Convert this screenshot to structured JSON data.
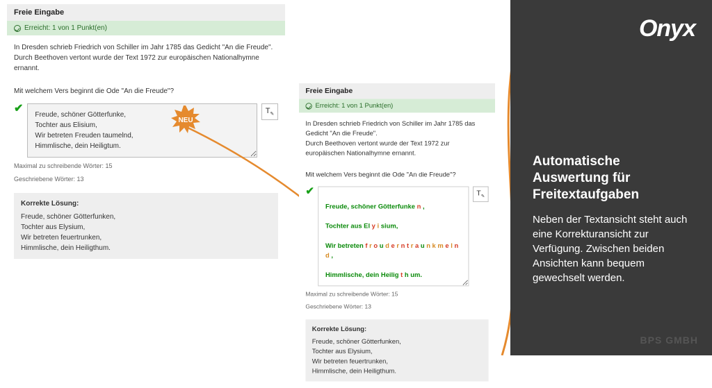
{
  "brand": {
    "logo": "Onyx",
    "footer": "BPS GMBH"
  },
  "promo": {
    "title": "Automatische Auswertung für Freitextaufgaben",
    "body": "Neben der Textansicht steht auch eine Korrekturansicht zur Verfügung. Zwischen beiden Ansichten kann bequem gewechselt werden."
  },
  "badge": {
    "label": "NEU"
  },
  "left": {
    "header": "Freie Eingabe",
    "score": "Erreicht: 1 von 1 Punkt(en)",
    "intro": "In Dresden schrieb Friedrich von Schiller im Jahr 1785 das Gedicht \"An die Freude\".\nDurch Beethoven vertont wurde der Text 1972 zur europäischen Nationalhymne ernannt.",
    "question": "Mit welchem Vers beginnt die Ode \"An die Freude\"?",
    "answer": "Freude, schöner Götterfunke,\nTochter aus Elisium,\nWir betreten Freuden taumelnd,\nHimmlische, dein Heiligtum.",
    "meta1": "Maximal zu schreibende Wörter: 15",
    "meta2": "Geschriebene Wörter: 13",
    "solution_h": "Korrekte Lösung:",
    "solution": "Freude, schöner Götterfunken,\nTochter aus Elysium,\nWir betreten feuertrunken,\nHimmlische, dein Heiligthum."
  },
  "right": {
    "header": "Freie Eingabe",
    "score": "Erreicht: 1 von 1 Punkt(en)",
    "intro": "In Dresden schrieb Friedrich von Schiller im Jahr 1785 das Gedicht \"An die Freude\".\nDurch Beethoven vertont wurde der Text 1972 zur europäischen Nationalhymne ernannt.",
    "question": "Mit welchem Vers beginnt die Ode \"An die Freude\"?",
    "meta1": "Maximal zu schreibende Wörter: 15",
    "meta2": "Geschriebene Wörter: 13",
    "solution_h": "Korrekte Lösung:",
    "solution": "Freude, schöner Götterfunken,\nTochter aus Elysium,\nWir betreten feuertrunken,\nHimmlische, dein Heiligthum."
  },
  "icons": {
    "toggle_glyph": "T"
  }
}
